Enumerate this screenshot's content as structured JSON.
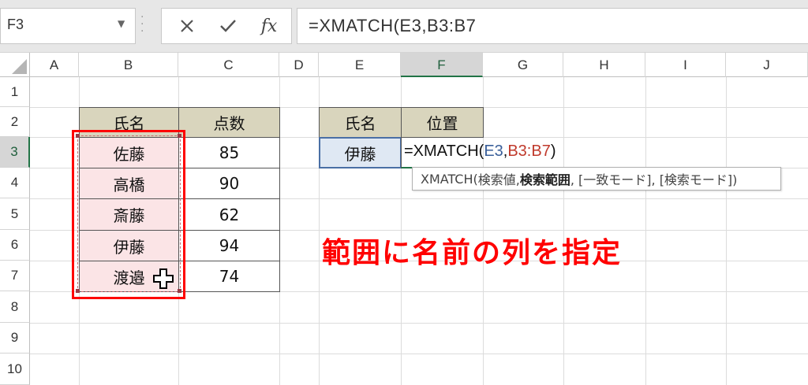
{
  "name_box": {
    "value": "F3"
  },
  "formula_bar": {
    "cancel_icon": "close-icon",
    "enter_icon": "check-icon",
    "fx_label": "fx",
    "formula": "=XMATCH(E3,B3:B7"
  },
  "columns": [
    "A",
    "B",
    "C",
    "D",
    "E",
    "F",
    "G",
    "H",
    "I",
    "J"
  ],
  "rows": [
    "1",
    "2",
    "3",
    "4",
    "5",
    "6",
    "7",
    "8",
    "9",
    "10"
  ],
  "table1": {
    "header_name": "氏名",
    "header_score": "点数",
    "rows": [
      {
        "name": "佐藤",
        "score": "85"
      },
      {
        "name": "高橋",
        "score": "90"
      },
      {
        "name": "斎藤",
        "score": "62"
      },
      {
        "name": "伊藤",
        "score": "94"
      },
      {
        "name": "渡邉",
        "score": "74"
      }
    ]
  },
  "table2": {
    "header_name": "氏名",
    "header_position": "位置",
    "lookup_value": "伊藤"
  },
  "active_cell": {
    "formula_start": "=XMATCH(",
    "ref1": "E3",
    "comma": ",",
    "ref2": "B3:B7",
    "close": ")"
  },
  "tooltip": {
    "func": "XMATCH(",
    "arg1": "検索値, ",
    "arg2": "検索範囲",
    "rest": ", [一致モード], [検索モード])"
  },
  "annotation": "範囲に名前の列を指定",
  "colors": {
    "ref1": "#3a5f9a",
    "ref2": "#c0392b",
    "highlight_border": "#ff0000",
    "header_fill": "#d9d5bd",
    "selected_fill": "#fbe4e6"
  }
}
